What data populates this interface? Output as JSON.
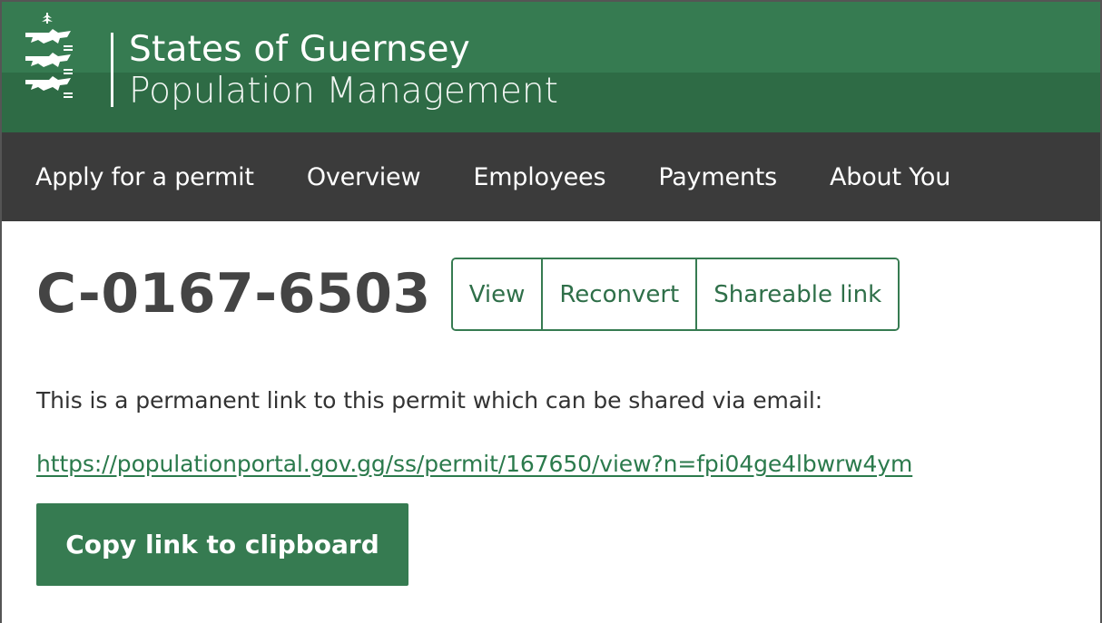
{
  "header": {
    "org_name": "States of Guernsey",
    "department": "Population Management",
    "logo_icon": "guernsey-crest-icon",
    "colors": {
      "primary_green": "#367b51",
      "dark_green": "#2e6b45",
      "nav_bg": "#3b3b3b"
    }
  },
  "nav": {
    "items": [
      {
        "label": "Apply for a permit"
      },
      {
        "label": "Overview"
      },
      {
        "label": "Employees"
      },
      {
        "label": "Payments"
      },
      {
        "label": "About You"
      }
    ]
  },
  "main": {
    "permit_id": "C-0167-6503",
    "actions": [
      {
        "label": "View"
      },
      {
        "label": "Reconvert"
      },
      {
        "label": "Shareable link"
      }
    ],
    "description": "This is a permanent link to this permit which can be shared via email:",
    "permanent_link": "https://populationportal.gov.gg/ss/permit/167650/view?n=fpi04ge4lbwrw4ym",
    "copy_button_label": "Copy link to clipboard"
  }
}
